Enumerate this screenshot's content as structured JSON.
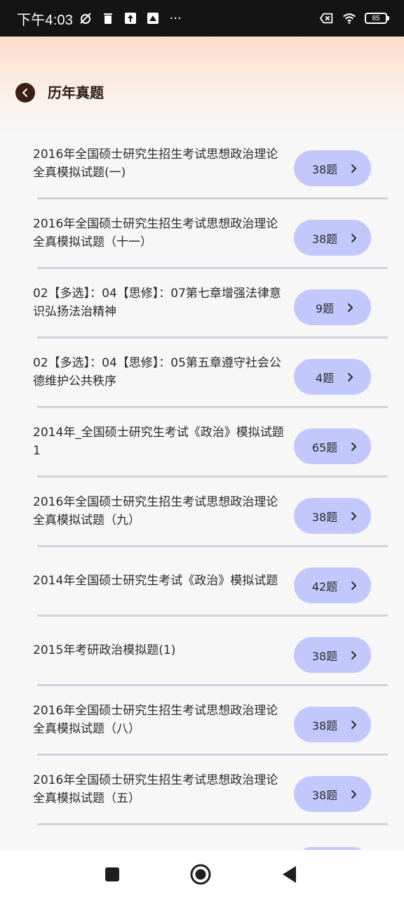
{
  "status_bar": {
    "time": "下午4:03",
    "battery": "85",
    "more_indicator": "···"
  },
  "header": {
    "title": "历年真题",
    "back_icon": "chevron-left-icon"
  },
  "items": [
    {
      "title": "2016年全国硕士研究生招生考试思想政治理论全真模拟试题(一)",
      "count": "38题"
    },
    {
      "title": "2016年全国硕士研究生招生考试思想政治理论全真模拟试题（十一）",
      "count": "38题"
    },
    {
      "title": "02【多选】：04【思修】：07第七章增强法律意识弘扬法治精神",
      "count": "9题"
    },
    {
      "title": "02【多选】：04【思修】：05第五章遵守社会公德维护公共秩序",
      "count": "4题"
    },
    {
      "title": "2014年_全国硕士研究生考试《政治》模拟试题1",
      "count": "65题"
    },
    {
      "title": "2016年全国硕士研究生招生考试思想政治理论全真模拟试题（九）",
      "count": "38题"
    },
    {
      "title": "2014年全国硕士研究生考试《政治》模拟试题",
      "count": "42题"
    },
    {
      "title": "2015年考研政治模拟题(1)",
      "count": "38题"
    },
    {
      "title": "2016年全国硕士研究生招生考试思想政治理论全真模拟试题（八）",
      "count": "38题"
    },
    {
      "title": "2016年全国硕士研究生招生考试思想政治理论全真模拟试题（五）",
      "count": "38题"
    }
  ],
  "colors": {
    "accent_button": "#c2c8fb",
    "back_button": "#3b1f12",
    "divider": "#cfd3dc"
  },
  "nav": {
    "icons": [
      "recents-square-icon",
      "home-circle-icon",
      "back-triangle-icon"
    ]
  }
}
